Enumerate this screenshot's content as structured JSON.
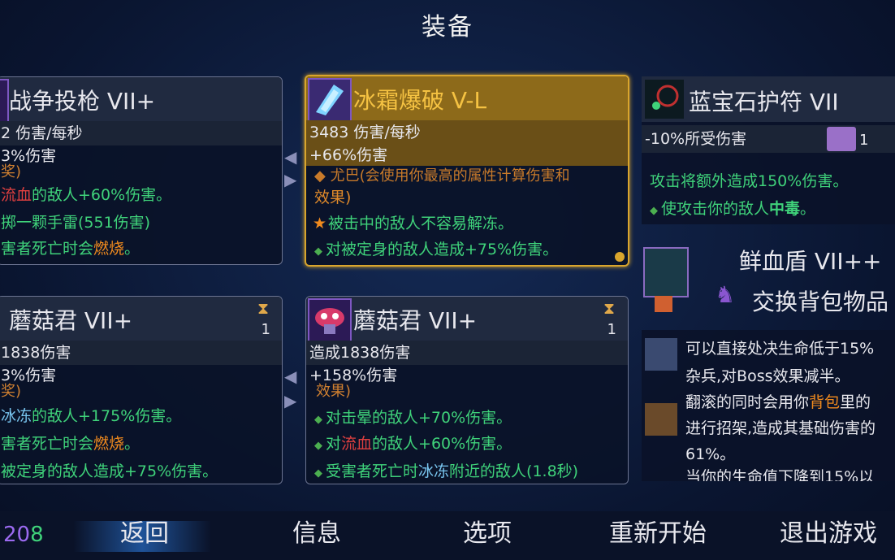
{
  "title": "装备",
  "cards": [
    {
      "name": "战争投枪 VII+",
      "stat1": "2 伤害/每秒",
      "stat2": "3%伤害",
      "partial": "奖)",
      "e1a": "流血",
      "e1b": "的敌人+60%伤害。",
      "e2": "掷一颗手雷(551伤害)",
      "e3a": "害者死亡时会",
      "e3b": "燃烧",
      "e3c": "。"
    },
    {
      "name": "冰霜爆破 V-L",
      "stat1": "3483 伤害/每秒",
      "stat2": "+66%伤害",
      "partial": "◆ 尤巴(会使用你最高的属性计算伤害和",
      "partial2": "效果)",
      "e1": "被击中的敌人不容易解冻。",
      "e2": "对被定身的敌人造成+75%伤害。"
    },
    {
      "name": "蘑菇君 VII+",
      "count": "1",
      "stat1": "1838伤害",
      "stat2": "3%伤害",
      "partial": "奖)",
      "e1a": "冰冻",
      "e1b": "的敌人+175%伤害。",
      "e2a": "害者死亡时会",
      "e2b": "燃烧",
      "e2c": "。",
      "e3": "被定身的敌人造成+75%伤害。"
    },
    {
      "name": "蘑菇君 VII+",
      "count": "1",
      "stat1": "造成1838伤害",
      "stat2": "+158%伤害",
      "partial": "效果)",
      "e1": "对击晕的敌人+70%伤害。",
      "e2a": "对",
      "e2b": "流血",
      "e2c": "的敌人+60%伤害。",
      "e3a": "受害者死亡时",
      "e3b": "冰冻",
      "e3c": "附近的敌人(1.8秒)"
    }
  ],
  "amulet": {
    "name": "蓝宝石护符 VII",
    "stat1": "-10%所受伤害",
    "scroll_count": "1",
    "e1": "攻击将额外造成150%伤害。",
    "e2a": "使攻击你的敌人",
    "e2b": "中毒",
    "e2c": "。"
  },
  "shield": {
    "name": "鲜血盾 VII++",
    "swap_label": "交换背包物品",
    "d1": "可以直接处决生命低于15%",
    "d2": "杂兵,对Boss效果减半。",
    "d3a": "翻滚的同时会用你",
    "d3b": "背包",
    "d3c": "里的",
    "d4": "进行招架,造成其基础伤害的",
    "d5": "61%。",
    "d6": "当你的生命值下降到15%以"
  },
  "nav": {
    "counter_a": "20",
    "counter_b": "8",
    "back": "返回",
    "info": "信息",
    "options": "选项",
    "restart": "重新开始",
    "quit": "退出游戏"
  }
}
